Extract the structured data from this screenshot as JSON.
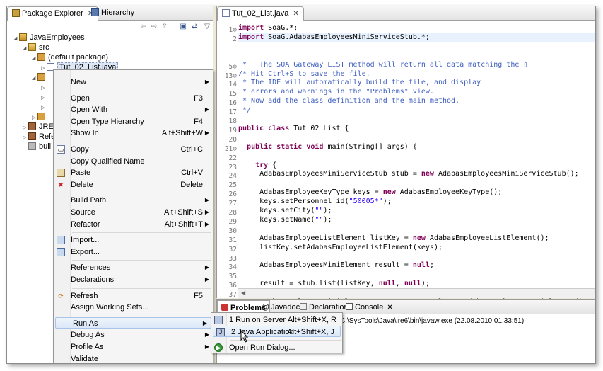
{
  "package_explorer": {
    "tabs": [
      {
        "label": "Package Explorer",
        "icon": "package-explorer-icon"
      },
      {
        "label": "Hierarchy",
        "icon": "hierarchy-icon"
      }
    ],
    "tree": {
      "project": "JavaEmployees",
      "src": "src",
      "default_package": "(default package)",
      "file": "Tut_02_List.java",
      "partial_items": [
        "JRE",
        "Refe",
        "buil"
      ]
    }
  },
  "editor": {
    "tab_label": "Tut_02_List.java",
    "line_numbers": [
      "1⊕",
      "2",
      "",
      "",
      "5⊕",
      "13⊖",
      "14",
      "15",
      "16",
      "17",
      "18",
      "19",
      "20",
      "21⊖",
      "22",
      "23",
      "24",
      "25",
      "26",
      "27",
      "28",
      "29",
      "30",
      "31",
      "32",
      "33",
      "34",
      "35",
      "36",
      "37",
      "38"
    ],
    "lines": [
      [
        {
          "t": "import",
          "c": "kw"
        },
        {
          "t": " SoaG.*;",
          "c": ""
        }
      ],
      [
        {
          "t": "import",
          "c": "kw"
        },
        {
          "t": " SoaG.AdabasEmployeesMiniServiceStub.*;",
          "c": ""
        }
      ],
      [],
      [],
      [
        {
          "t": " *   The SOA Gateway LIST method will return all data matching the ▯",
          "c": "cm"
        }
      ],
      [
        {
          "t": "/* Hit Ctrl+S to save the file.",
          "c": "cm"
        }
      ],
      [
        {
          "t": " * The IDE will automatically build the file, and display",
          "c": "cm"
        }
      ],
      [
        {
          "t": " * errors and warnings in the \"Problems\" view.",
          "c": "cm"
        }
      ],
      [
        {
          "t": " * Now add the class definition and the main method.",
          "c": "cm"
        }
      ],
      [
        {
          "t": " */",
          "c": "cm"
        }
      ],
      [],
      [
        {
          "t": "public class",
          "c": "kw"
        },
        {
          "t": " Tut_02_List {",
          "c": ""
        }
      ],
      [],
      [
        {
          "t": "  ",
          "c": ""
        },
        {
          "t": "public static void",
          "c": "kw"
        },
        {
          "t": " main(String[] args) {",
          "c": ""
        }
      ],
      [],
      [
        {
          "t": "    ",
          "c": ""
        },
        {
          "t": "try",
          "c": "kw"
        },
        {
          "t": " {",
          "c": ""
        }
      ],
      [
        {
          "t": "     AdabasEmployeesMiniServiceStub stub = ",
          "c": ""
        },
        {
          "t": "new",
          "c": "kw"
        },
        {
          "t": " AdabasEmployeesMiniServiceStub();",
          "c": ""
        }
      ],
      [],
      [
        {
          "t": "     AdabasEmployeeKeyType keys = ",
          "c": ""
        },
        {
          "t": "new",
          "c": "kw"
        },
        {
          "t": " AdabasEmployeeKeyType();",
          "c": ""
        }
      ],
      [
        {
          "t": "     keys.setPersonnel_id(",
          "c": ""
        },
        {
          "t": "\"50005*\"",
          "c": "st"
        },
        {
          "t": ");",
          "c": ""
        }
      ],
      [
        {
          "t": "     keys.setCity(",
          "c": ""
        },
        {
          "t": "\"\"",
          "c": "st"
        },
        {
          "t": ");",
          "c": ""
        }
      ],
      [
        {
          "t": "     keys.setName(",
          "c": ""
        },
        {
          "t": "\"\"",
          "c": "st"
        },
        {
          "t": ");",
          "c": ""
        }
      ],
      [],
      [
        {
          "t": "     AdabasEmployeeListElement listKey = ",
          "c": ""
        },
        {
          "t": "new",
          "c": "kw"
        },
        {
          "t": " AdabasEmployeeListElement();",
          "c": ""
        }
      ],
      [
        {
          "t": "     listKey.setAdabasEmployeeListElement(keys);",
          "c": ""
        }
      ],
      [],
      [
        {
          "t": "     AdabasEmployeesMiniElement result = ",
          "c": ""
        },
        {
          "t": "null",
          "c": "kw"
        },
        {
          "t": ";",
          "c": ""
        }
      ],
      [],
      [
        {
          "t": "     result = stub.list(listKey, ",
          "c": ""
        },
        {
          "t": "null",
          "c": "kw"
        },
        {
          "t": ", ",
          "c": ""
        },
        {
          "t": "null",
          "c": "kw"
        },
        {
          "t": ");",
          "c": ""
        }
      ],
      [],
      [
        {
          "t": "     AdabasEmployeesMiniElementType root = result.getAdabasEmployeesMiniElement();",
          "c": ""
        }
      ]
    ]
  },
  "bottom_panel": {
    "tabs": [
      {
        "label": "Problems",
        "icon": "problems-icon"
      },
      {
        "label": "Javadoc",
        "icon": "javadoc-icon"
      },
      {
        "label": "Declaration",
        "icon": "declaration-icon"
      },
      {
        "label": "Console",
        "icon": "console-icon"
      }
    ],
    "console_text": "C:\\SysTools\\Java\\jre6\\bin\\javaw.exe (22.08.2010 01:33:51)"
  },
  "context_menu": [
    {
      "label": "New",
      "shortcut": "",
      "submenu": true
    },
    {
      "sep": true
    },
    {
      "label": "Open",
      "shortcut": "F3"
    },
    {
      "label": "Open With",
      "shortcut": "",
      "submenu": true
    },
    {
      "label": "Open Type Hierarchy",
      "shortcut": "F4"
    },
    {
      "label": "Show In",
      "shortcut": "Alt+Shift+W",
      "submenu": true
    },
    {
      "sep": true
    },
    {
      "label": "Copy",
      "shortcut": "Ctrl+C",
      "icon": "copy-icon"
    },
    {
      "label": "Copy Qualified Name",
      "shortcut": ""
    },
    {
      "label": "Paste",
      "shortcut": "Ctrl+V",
      "icon": "paste-icon"
    },
    {
      "label": "Delete",
      "shortcut": "Delete",
      "icon": "delete-icon"
    },
    {
      "sep": true
    },
    {
      "label": "Build Path",
      "shortcut": "",
      "submenu": true
    },
    {
      "label": "Source",
      "shortcut": "Alt+Shift+S",
      "submenu": true
    },
    {
      "label": "Refactor",
      "shortcut": "Alt+Shift+T",
      "submenu": true
    },
    {
      "sep": true
    },
    {
      "label": "Import...",
      "shortcut": "",
      "icon": "import-icon"
    },
    {
      "label": "Export...",
      "shortcut": "",
      "icon": "export-icon"
    },
    {
      "sep": true
    },
    {
      "label": "References",
      "shortcut": "",
      "submenu": true
    },
    {
      "label": "Declarations",
      "shortcut": "",
      "submenu": true
    },
    {
      "sep": true
    },
    {
      "label": "Refresh",
      "shortcut": "F5",
      "icon": "refresh-icon"
    },
    {
      "label": "Assign Working Sets...",
      "shortcut": ""
    },
    {
      "sep": true
    },
    {
      "label": "Run As",
      "shortcut": "",
      "submenu": true,
      "highlight": true
    },
    {
      "label": "Debug As",
      "shortcut": "",
      "submenu": true
    },
    {
      "label": "Profile As",
      "shortcut": "",
      "submenu": true
    },
    {
      "label": "Validate",
      "shortcut": ""
    }
  ],
  "run_as_submenu": [
    {
      "label": "1 Run on Server",
      "shortcut": "Alt+Shift+X, R",
      "icon": "server-icon"
    },
    {
      "label": "2 Java Application",
      "shortcut": "Alt+Shift+X, J",
      "icon": "java-app-icon",
      "highlight": true
    },
    {
      "sep": true
    },
    {
      "label": "Open Run Dialog...",
      "shortcut": "",
      "icon": "run-icon"
    }
  ]
}
